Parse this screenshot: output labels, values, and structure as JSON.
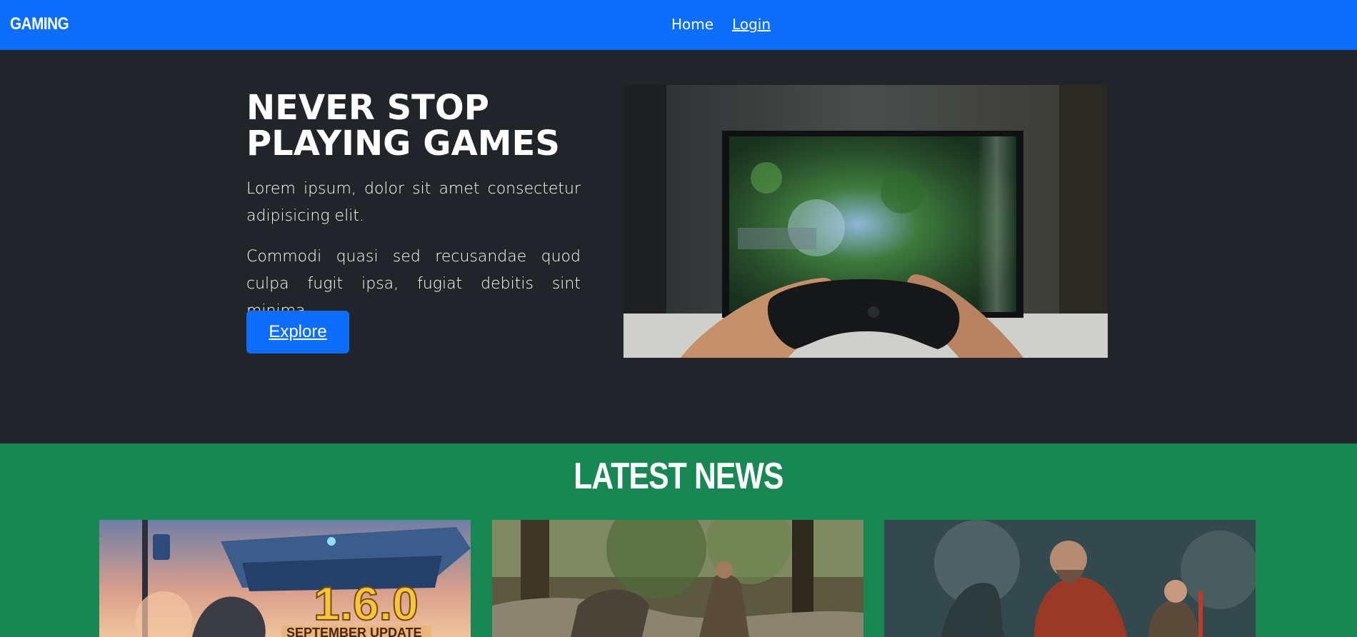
{
  "navbar": {
    "brand": "GAMING",
    "links": [
      {
        "label": "Home"
      },
      {
        "label": "Login"
      }
    ],
    "bg_color": "#0d6efd"
  },
  "hero": {
    "title_line1": "NEVER STOP",
    "title_line2": "PLAYING GAMES",
    "paragraph1": "Lorem ipsum, dolor sit amet consectetur adipisicing elit.",
    "paragraph2": "Commodi quasi sed recusandae quod culpa fugit ipsa, fugiat debitis sint minima.",
    "button_label": "Explore",
    "bg_color": "#212529"
  },
  "news": {
    "title": "LATEST NEWS",
    "bg_color": "#198754",
    "cards": [
      {
        "image_text_main": "1.6.0",
        "image_text_sub": "SEPTEMBER UPDATE"
      },
      {},
      {}
    ]
  }
}
